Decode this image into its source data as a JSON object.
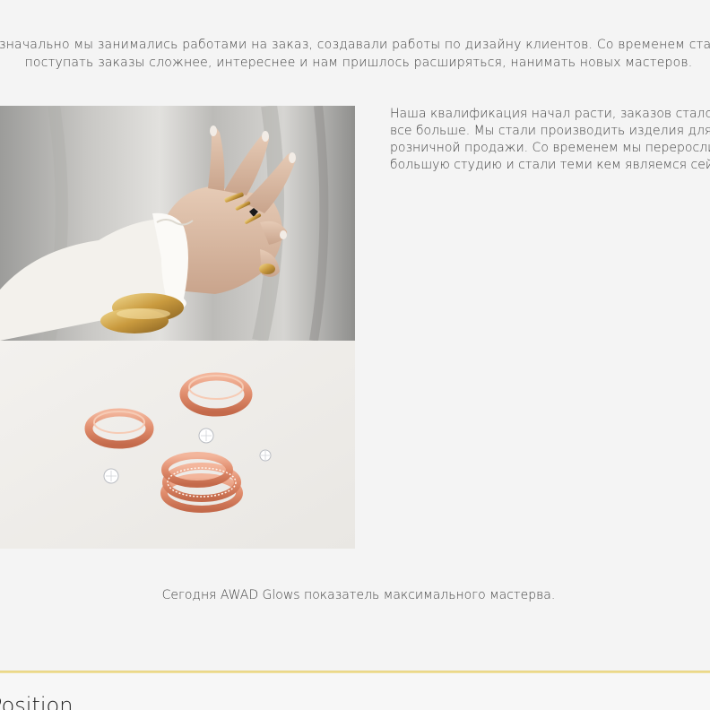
{
  "intro": {
    "line1": "Изначально мы занимались работами на заказ, создавали работы по дизайну клиентов. Со временем стали",
    "line2": "поступать заказы сложнее, интереснее и нам пришлось расширяться, нанимать новых мастеров."
  },
  "images": {
    "hand": "hand-with-rings-photo",
    "rings": "rose-gold-rings-photo"
  },
  "side_text": "Наша квалификация начал расти, заказов стало\nвсе больше. Мы стали производить изделия для\nрозничной продажи. Со временем мы переросли\nбольшую студию и стали теми кем являемся сейчас",
  "today_text": "Сегодня AWAD Glows показатель максимального мастерва.",
  "section_heading": "Position",
  "colors": {
    "background": "#f4f4f4",
    "divider": "#e8d27a",
    "text": "#444444"
  }
}
